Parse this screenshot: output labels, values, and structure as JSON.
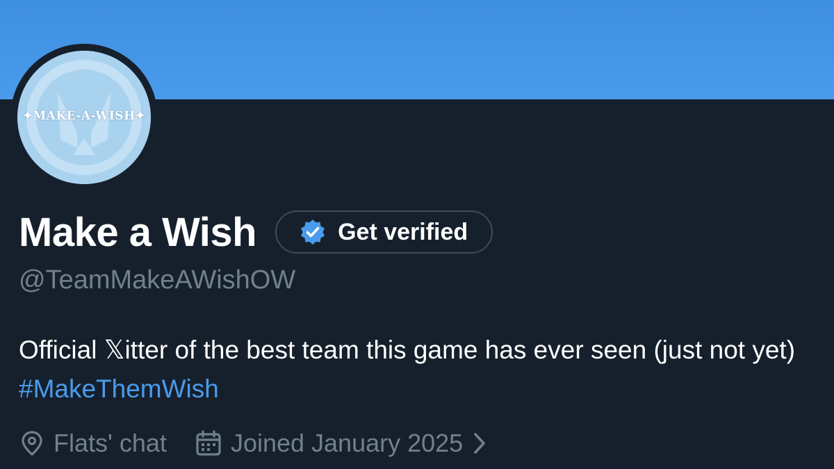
{
  "colors": {
    "banner": "#4a9bec",
    "background": "#16202c",
    "accent": "#4a9bec",
    "muted": "#71808f",
    "pill_border": "#3e4a56",
    "avatar_fill": "#a9d2ef"
  },
  "avatar": {
    "logo_text": "✦MAKE-A-WISH✦",
    "icon": "overwatch-emblem-icon"
  },
  "profile": {
    "display_name": "Make a Wish",
    "handle": "@TeamMakeAWishOW",
    "bio_text": "Official 𝕏itter of the best team this game has ever seen (just not yet) ",
    "bio_hashtag": "#MakeThemWish",
    "location": "Flats' chat",
    "joined": "Joined January 2025"
  },
  "actions": {
    "get_verified_label": "Get verified",
    "get_verified_icon": "verified-badge-icon"
  },
  "icons": {
    "location": "location-pin-icon",
    "calendar": "calendar-icon",
    "chevron": "chevron-right-icon"
  }
}
